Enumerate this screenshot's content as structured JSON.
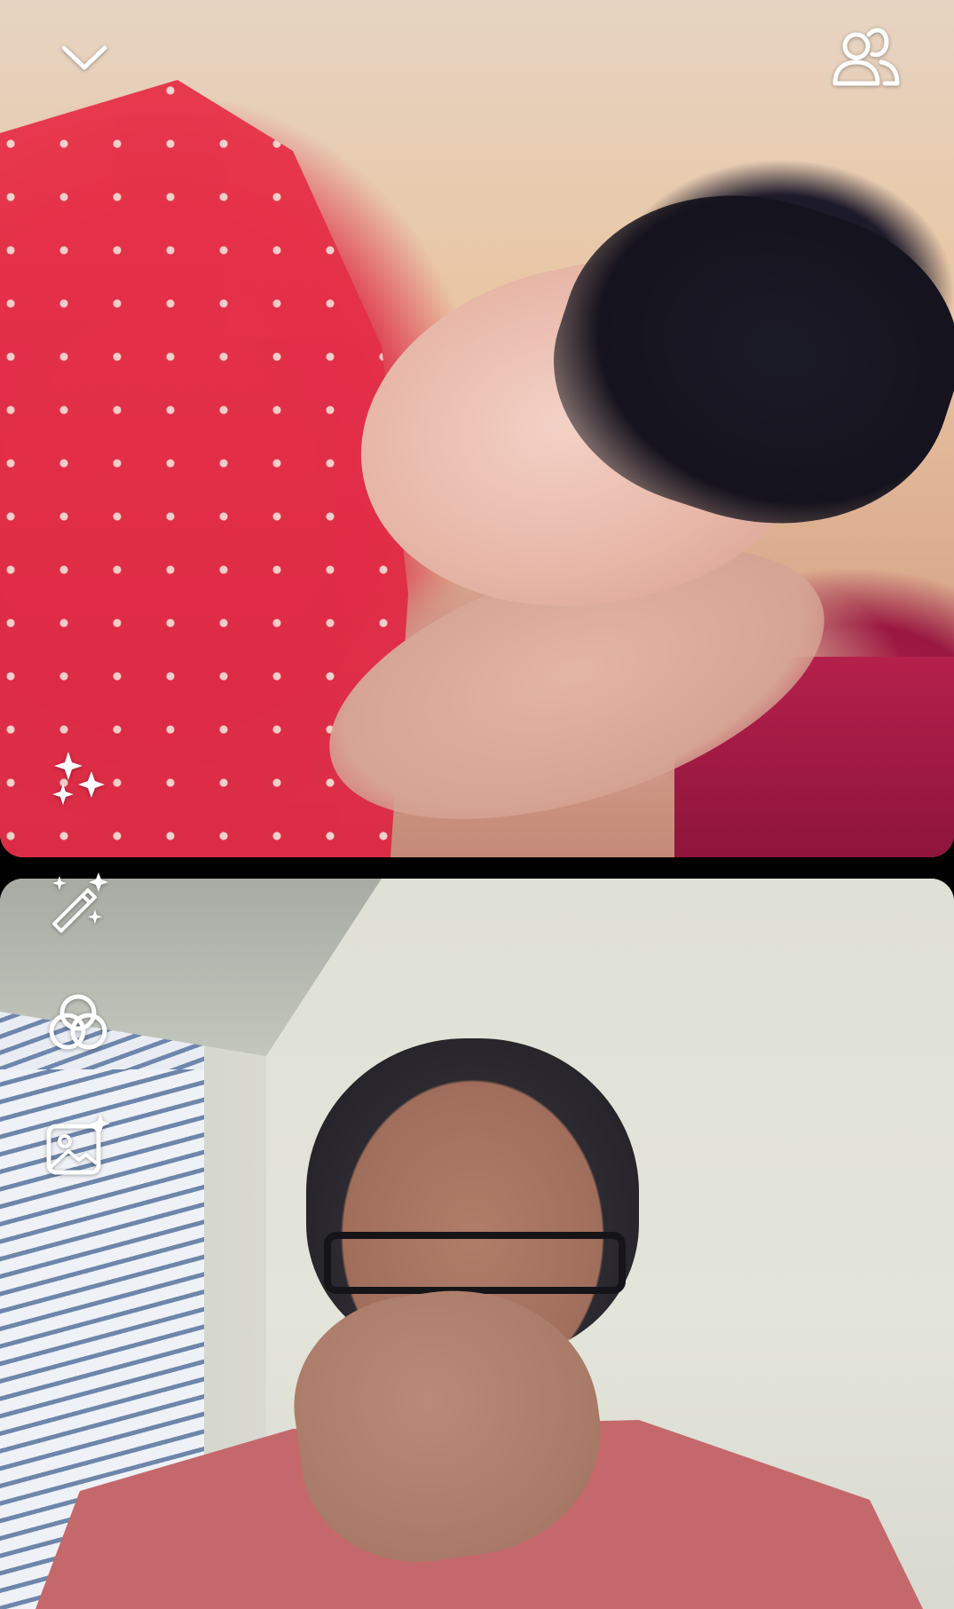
{
  "call": {
    "remote_video_label": "",
    "local_video_label": ""
  },
  "controls": {
    "top_left": {
      "icon": "chevron-down-icon"
    },
    "top_right": {
      "icon": "participants-icon"
    },
    "side": [
      {
        "icon": "sparkles-icon"
      },
      {
        "icon": "magic-wand-icon"
      },
      {
        "icon": "color-circles-icon"
      },
      {
        "icon": "image-sparkle-icon"
      }
    ]
  },
  "colors": {
    "background": "#000000",
    "icon": "#ffffff",
    "remote_clothing": "#e2304a",
    "local_shirt": "#c5686b"
  }
}
